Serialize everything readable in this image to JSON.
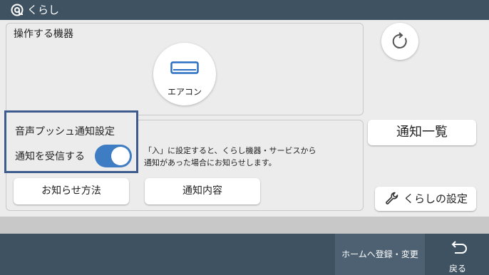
{
  "header": {
    "title": "くらし",
    "logo_icon": "kurashi-logo-icon"
  },
  "devices_panel": {
    "title": "操作する機器",
    "devices": [
      {
        "label": "エアコン",
        "icon": "air-conditioner-icon"
      }
    ]
  },
  "refresh_button": {
    "icon": "refresh-icon"
  },
  "voice_push": {
    "title": "音声プッシュ通知設定",
    "receive_label": "通知を受信する",
    "receive_enabled": true,
    "description_line1": "「入」に設定すると、くらし機器・サービスから",
    "description_line2": "通知があった場合にお知らせします。",
    "howto_button": "お知らせ方法",
    "content_button": "通知内容"
  },
  "notification_list_button": "通知一覧",
  "kurashi_settings_button": {
    "label": "くらしの設定",
    "icon": "wrench-icon"
  },
  "footer": {
    "home_register_button": "ホームへ登録・変更",
    "back_button": {
      "label": "戻る",
      "icon": "back-arrow-icon"
    }
  },
  "colors": {
    "header_bg": "#3f5262",
    "highlight_border": "#3d5b8c",
    "toggle_on": "#3e7cc4",
    "aircon_icon": "#2b6fc4"
  }
}
